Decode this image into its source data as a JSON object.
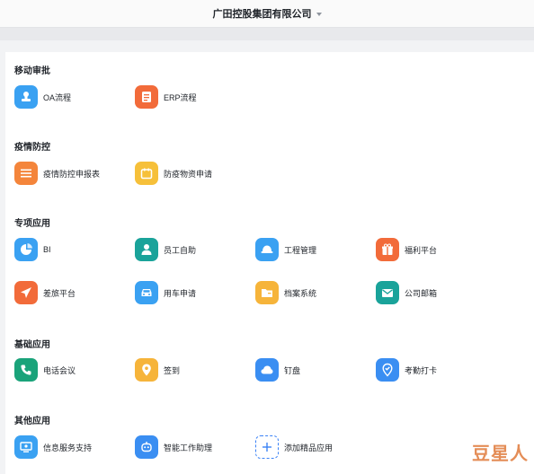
{
  "header": {
    "org_name": "广田控股集团有限公司"
  },
  "sections": [
    {
      "title": "移动审批",
      "apps": [
        {
          "label": "OA流程",
          "icon": "stamp-icon",
          "color": "#3aa1f2"
        },
        {
          "label": "ERP流程",
          "icon": "document-list-icon",
          "color": "#f26b3a"
        }
      ]
    },
    {
      "title": "疫情防控",
      "apps": [
        {
          "label": "疫情防控申报表",
          "icon": "form-lines-icon",
          "color": "#f4853b"
        },
        {
          "label": "防疫物资申请",
          "icon": "calendar-box-icon",
          "color": "#f6c03a"
        }
      ]
    },
    {
      "title": "专项应用",
      "apps": [
        {
          "label": "BI",
          "icon": "pie-chart-icon",
          "color": "#3aa1f2"
        },
        {
          "label": "员工自助",
          "icon": "person-icon",
          "color": "#1aa39a"
        },
        {
          "label": "工程管理",
          "icon": "helmet-icon",
          "color": "#3aa1f2"
        },
        {
          "label": "福利平台",
          "icon": "gift-icon",
          "color": "#f26b3a"
        },
        {
          "label": "差旅平台",
          "icon": "airplane-icon",
          "color": "#f26b3a"
        },
        {
          "label": "用车申请",
          "icon": "car-icon",
          "color": "#3aa1f2"
        },
        {
          "label": "档案系统",
          "icon": "folder-icon",
          "color": "#f6b43a"
        },
        {
          "label": "公司邮箱",
          "icon": "mail-icon",
          "color": "#1aa39a"
        }
      ]
    },
    {
      "title": "基础应用",
      "apps": [
        {
          "label": "电话会议",
          "icon": "phone-icon",
          "color": "#1aa37a"
        },
        {
          "label": "签到",
          "icon": "location-pin-icon",
          "color": "#f6b43a"
        },
        {
          "label": "钉盘",
          "icon": "cloud-icon",
          "color": "#3a8ef2"
        },
        {
          "label": "考勤打卡",
          "icon": "check-pin-icon",
          "color": "#3a8ef2"
        }
      ]
    },
    {
      "title": "其他应用",
      "apps": [
        {
          "label": "信息服务支持",
          "icon": "monitor-icon",
          "color": "#3aa1f2"
        },
        {
          "label": "智能工作助理",
          "icon": "robot-icon",
          "color": "#3a8ef2"
        },
        {
          "label": "添加精品应用",
          "icon": "plus-icon",
          "color": "#3b82f6"
        }
      ]
    }
  ],
  "watermark": {
    "text": "豆星人"
  }
}
